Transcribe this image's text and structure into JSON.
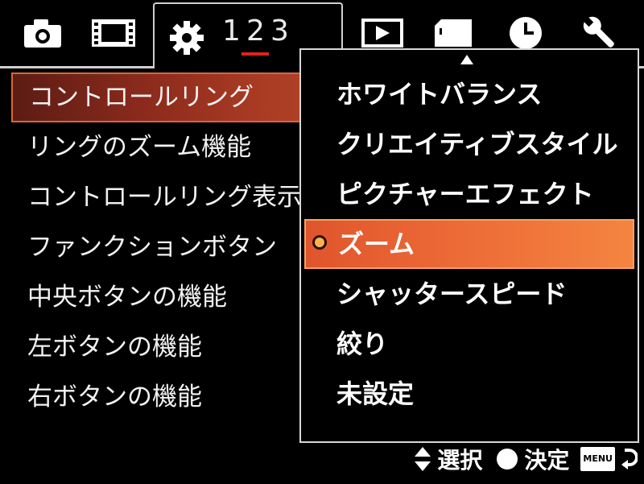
{
  "tabs": [
    {
      "icon": "camera-icon"
    },
    {
      "icon": "film-icon"
    },
    {
      "icon": "gear-icon",
      "pages": [
        "1",
        "2",
        "3"
      ],
      "current_page": "2"
    },
    {
      "icon": "playback-icon"
    },
    {
      "icon": "memory-card-icon"
    },
    {
      "icon": "clock-icon"
    },
    {
      "icon": "wrench-icon"
    }
  ],
  "menu": {
    "items": [
      {
        "label": "コントロールリング"
      },
      {
        "label": "リングのズーム機能"
      },
      {
        "label": "コントロールリング表示"
      },
      {
        "label": "ファンクションボタン"
      },
      {
        "label": "中央ボタンの機能"
      },
      {
        "label": "左ボタンの機能"
      },
      {
        "label": "右ボタンの機能"
      }
    ],
    "selected_index": 0
  },
  "dropdown": {
    "options": [
      {
        "label": "ホワイトバランス"
      },
      {
        "label": "クリエイティブスタイル"
      },
      {
        "label": "ピクチャーエフェクト"
      },
      {
        "label": "ズーム"
      },
      {
        "label": "シャッタースピード"
      },
      {
        "label": "絞り"
      },
      {
        "label": "未設定"
      }
    ],
    "selected_index": 3
  },
  "hints": {
    "select_label": "選択",
    "confirm_label": "決定",
    "menu_key": "MENU"
  },
  "colors": {
    "selected_menu_row": "#8a2a1c",
    "selected_option_row": "#ec6a36",
    "page_underline": "#e2231a",
    "frame_line": "#cfcfcf"
  }
}
